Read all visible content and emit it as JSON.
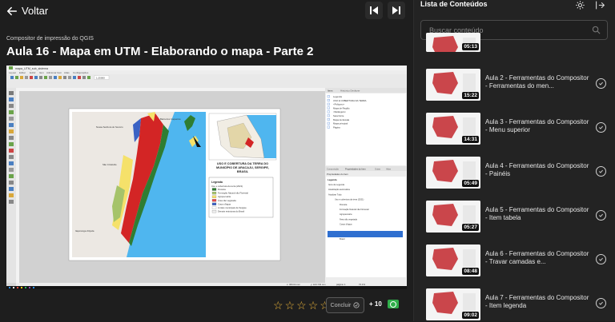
{
  "header": {
    "back_label": "Voltar"
  },
  "course": {
    "subtitle": "Compositor de impressão do QGIS",
    "title": "Aula 16 - Mapa em UTM - Elaborando o mapa - Parte 2"
  },
  "video": {
    "app_title": "mapa_UTM_sub_sistema",
    "scale_text": "1:25000",
    "map_title": "USO E COBERTURA DA TERRA DO MUNICÍPIO DE ARACAJU, SERGIPE, BRASIL",
    "legend_title": "Legenda",
    "legend_subtitle": "Uso e cobertura da terra (2021)",
    "legend_items": [
      {
        "label": "Floresta",
        "color": "#2f7d32"
      },
      {
        "label": "Formação Natural não Florestal",
        "color": "#a5c36a"
      },
      {
        "label": "Agropecuária",
        "color": "#f5e16a"
      },
      {
        "label": "Área não vegetada",
        "color": "#e34a4a"
      },
      {
        "label": "Corpo d'água",
        "color": "#3b62c4"
      },
      {
        "label": "Limites municipais de Sergipe",
        "color": "#ffffff"
      },
      {
        "label": "Demais estruturas do Brasil",
        "color": "#eeeeee"
      }
    ],
    "map_labels": [
      "Nossa Senhora do Socorro",
      "São Cristóvão",
      "Barra dos Coqueiros",
      "Itaporanga d'Ajuda"
    ],
    "panel_tabs": [
      "Itens",
      "Histórico Desfazer"
    ],
    "layer_items": [
      "Legenda",
      "USO E COBERTURA DA TERRA",
      "<Polígono>",
      "Mapa de Região",
      "<Retângulo>",
      "Seta Norte",
      "Mapa de Escala",
      "Mapa principal",
      "Página"
    ],
    "prop_tabs": [
      "Composição",
      "Propriedades do Item",
      "Guias",
      "Atlas"
    ],
    "prop_header": "Propriedades do Item",
    "legend_panel_title": "Legenda",
    "legend_panel_items": [
      "Itens da Legenda",
      "Atualização automática",
      "Atualizar Tudo",
      "Uso e cobertura da terra (2021)",
      "Floresta",
      "Formação Natural não Florestal",
      "Agropecuária",
      "Área não vegetada",
      "Corpo d'água",
      "Limites municipais de Sergipe",
      "Demais estruturas do Brasil",
      "Brasil"
    ],
    "status_x": "x: 306.64 mm",
    "status_y": "y: 103.733 mm",
    "status_page": "página: 1",
    "status_zoom": "72.1%"
  },
  "actions": {
    "stars": 5,
    "conclude_label": "Concluir",
    "points": "+ 10"
  },
  "playlist": {
    "title": "Lista de Conteúdos",
    "search_placeholder": "Buscar conteúdo",
    "lessons": [
      {
        "duration": "05:13",
        "title": ""
      },
      {
        "duration": "15:22",
        "title": "Aula 2 - Ferramentas do Compositor - Ferramentas do men..."
      },
      {
        "duration": "14:31",
        "title": "Aula 3 - Ferramentas do Compositor - Menu superior"
      },
      {
        "duration": "05:49",
        "title": "Aula 4 - Ferramentas do Compositor - Painéis"
      },
      {
        "duration": "05:27",
        "title": "Aula 5 - Ferramentas do Compositor - Item tabela"
      },
      {
        "duration": "08:48",
        "title": "Aula 6 - Ferramentas do Compositor - Travar camadas e..."
      },
      {
        "duration": "09:02",
        "title": "Aula 7 - Ferramentas do Compositor - Item legenda"
      }
    ]
  }
}
